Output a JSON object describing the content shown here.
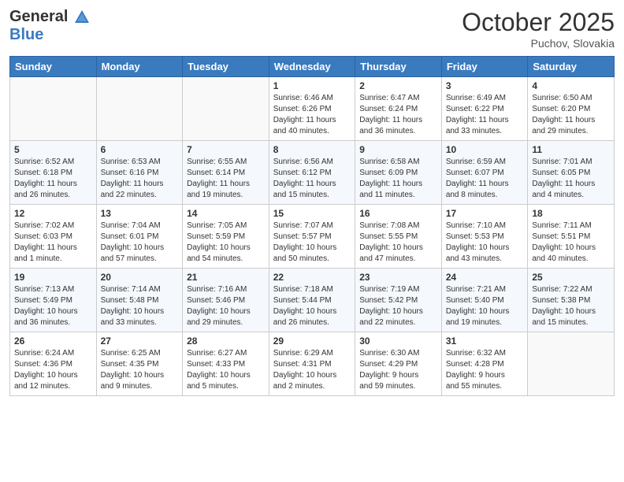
{
  "header": {
    "logo_line1": "General",
    "logo_line2": "Blue",
    "month": "October 2025",
    "location": "Puchov, Slovakia"
  },
  "weekdays": [
    "Sunday",
    "Monday",
    "Tuesday",
    "Wednesday",
    "Thursday",
    "Friday",
    "Saturday"
  ],
  "weeks": [
    [
      {
        "day": "",
        "info": ""
      },
      {
        "day": "",
        "info": ""
      },
      {
        "day": "",
        "info": ""
      },
      {
        "day": "1",
        "info": "Sunrise: 6:46 AM\nSunset: 6:26 PM\nDaylight: 11 hours\nand 40 minutes."
      },
      {
        "day": "2",
        "info": "Sunrise: 6:47 AM\nSunset: 6:24 PM\nDaylight: 11 hours\nand 36 minutes."
      },
      {
        "day": "3",
        "info": "Sunrise: 6:49 AM\nSunset: 6:22 PM\nDaylight: 11 hours\nand 33 minutes."
      },
      {
        "day": "4",
        "info": "Sunrise: 6:50 AM\nSunset: 6:20 PM\nDaylight: 11 hours\nand 29 minutes."
      }
    ],
    [
      {
        "day": "5",
        "info": "Sunrise: 6:52 AM\nSunset: 6:18 PM\nDaylight: 11 hours\nand 26 minutes."
      },
      {
        "day": "6",
        "info": "Sunrise: 6:53 AM\nSunset: 6:16 PM\nDaylight: 11 hours\nand 22 minutes."
      },
      {
        "day": "7",
        "info": "Sunrise: 6:55 AM\nSunset: 6:14 PM\nDaylight: 11 hours\nand 19 minutes."
      },
      {
        "day": "8",
        "info": "Sunrise: 6:56 AM\nSunset: 6:12 PM\nDaylight: 11 hours\nand 15 minutes."
      },
      {
        "day": "9",
        "info": "Sunrise: 6:58 AM\nSunset: 6:09 PM\nDaylight: 11 hours\nand 11 minutes."
      },
      {
        "day": "10",
        "info": "Sunrise: 6:59 AM\nSunset: 6:07 PM\nDaylight: 11 hours\nand 8 minutes."
      },
      {
        "day": "11",
        "info": "Sunrise: 7:01 AM\nSunset: 6:05 PM\nDaylight: 11 hours\nand 4 minutes."
      }
    ],
    [
      {
        "day": "12",
        "info": "Sunrise: 7:02 AM\nSunset: 6:03 PM\nDaylight: 11 hours\nand 1 minute."
      },
      {
        "day": "13",
        "info": "Sunrise: 7:04 AM\nSunset: 6:01 PM\nDaylight: 10 hours\nand 57 minutes."
      },
      {
        "day": "14",
        "info": "Sunrise: 7:05 AM\nSunset: 5:59 PM\nDaylight: 10 hours\nand 54 minutes."
      },
      {
        "day": "15",
        "info": "Sunrise: 7:07 AM\nSunset: 5:57 PM\nDaylight: 10 hours\nand 50 minutes."
      },
      {
        "day": "16",
        "info": "Sunrise: 7:08 AM\nSunset: 5:55 PM\nDaylight: 10 hours\nand 47 minutes."
      },
      {
        "day": "17",
        "info": "Sunrise: 7:10 AM\nSunset: 5:53 PM\nDaylight: 10 hours\nand 43 minutes."
      },
      {
        "day": "18",
        "info": "Sunrise: 7:11 AM\nSunset: 5:51 PM\nDaylight: 10 hours\nand 40 minutes."
      }
    ],
    [
      {
        "day": "19",
        "info": "Sunrise: 7:13 AM\nSunset: 5:49 PM\nDaylight: 10 hours\nand 36 minutes."
      },
      {
        "day": "20",
        "info": "Sunrise: 7:14 AM\nSunset: 5:48 PM\nDaylight: 10 hours\nand 33 minutes."
      },
      {
        "day": "21",
        "info": "Sunrise: 7:16 AM\nSunset: 5:46 PM\nDaylight: 10 hours\nand 29 minutes."
      },
      {
        "day": "22",
        "info": "Sunrise: 7:18 AM\nSunset: 5:44 PM\nDaylight: 10 hours\nand 26 minutes."
      },
      {
        "day": "23",
        "info": "Sunrise: 7:19 AM\nSunset: 5:42 PM\nDaylight: 10 hours\nand 22 minutes."
      },
      {
        "day": "24",
        "info": "Sunrise: 7:21 AM\nSunset: 5:40 PM\nDaylight: 10 hours\nand 19 minutes."
      },
      {
        "day": "25",
        "info": "Sunrise: 7:22 AM\nSunset: 5:38 PM\nDaylight: 10 hours\nand 15 minutes."
      }
    ],
    [
      {
        "day": "26",
        "info": "Sunrise: 6:24 AM\nSunset: 4:36 PM\nDaylight: 10 hours\nand 12 minutes."
      },
      {
        "day": "27",
        "info": "Sunrise: 6:25 AM\nSunset: 4:35 PM\nDaylight: 10 hours\nand 9 minutes."
      },
      {
        "day": "28",
        "info": "Sunrise: 6:27 AM\nSunset: 4:33 PM\nDaylight: 10 hours\nand 5 minutes."
      },
      {
        "day": "29",
        "info": "Sunrise: 6:29 AM\nSunset: 4:31 PM\nDaylight: 10 hours\nand 2 minutes."
      },
      {
        "day": "30",
        "info": "Sunrise: 6:30 AM\nSunset: 4:29 PM\nDaylight: 9 hours\nand 59 minutes."
      },
      {
        "day": "31",
        "info": "Sunrise: 6:32 AM\nSunset: 4:28 PM\nDaylight: 9 hours\nand 55 minutes."
      },
      {
        "day": "",
        "info": ""
      }
    ]
  ]
}
